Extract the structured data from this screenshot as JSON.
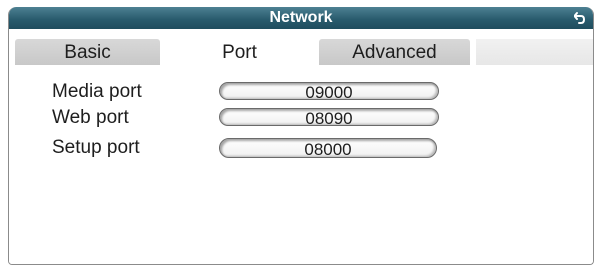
{
  "window": {
    "title": "Network"
  },
  "tabs": [
    {
      "label": "Basic"
    },
    {
      "label": "Port"
    },
    {
      "label": "Advanced"
    }
  ],
  "ports": {
    "media": {
      "label": "Media port",
      "value": "09000"
    },
    "web": {
      "label": "Web port",
      "value": "08090"
    },
    "setup": {
      "label": "Setup port",
      "value": "08000"
    }
  },
  "colors": {
    "titlebar": "#2a5c6e",
    "inactive_tab": "#cfcfcf",
    "text": "#1e1e1e"
  }
}
